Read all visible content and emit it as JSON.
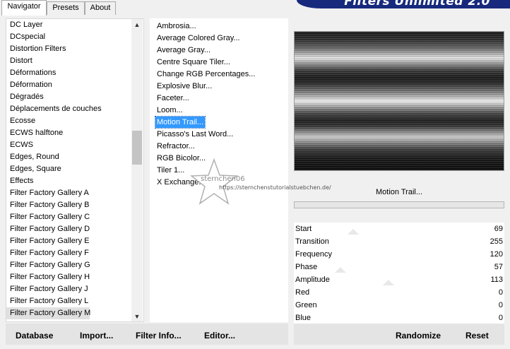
{
  "tabs": [
    {
      "label": "Navigator",
      "active": true
    },
    {
      "label": "Presets",
      "active": false
    },
    {
      "label": "About",
      "active": false
    }
  ],
  "brand": {
    "title": "Filters Unlimited 2.0"
  },
  "categories": {
    "items": [
      "DC Layer",
      "DCspecial",
      "Distortion Filters",
      "Distort",
      "Déformations",
      "Déformation",
      "Dégradés",
      "Déplacements de couches",
      "Ecosse",
      "ECWS halftone",
      "ECWS",
      "Edges, Round",
      "Edges, Square",
      "Effects",
      "Filter Factory Gallery A",
      "Filter Factory Gallery B",
      "Filter Factory Gallery C",
      "Filter Factory Gallery D",
      "Filter Factory Gallery E",
      "Filter Factory Gallery F",
      "Filter Factory Gallery G",
      "Filter Factory Gallery H",
      "Filter Factory Gallery J",
      "Filter Factory Gallery L",
      "Filter Factory Gallery M"
    ],
    "selected": "Filter Factory Gallery M",
    "scroll_position": 0.42
  },
  "filters": {
    "items": [
      "Ambrosia...",
      "Average Colored Gray...",
      "Average Gray...",
      "Centre Square Tiler...",
      "Change RGB Percentages...",
      "Explosive Blur...",
      "Faceter...",
      "Loom...",
      "Motion Trail...",
      "Picasso's Last Word...",
      "Refractor...",
      "RGB Bicolor...",
      "Tiler 1...",
      "X Exchange..."
    ],
    "selected": "Motion Trail..."
  },
  "watermark": {
    "name": "sternchen06",
    "url": "https://sternchenstutorialstuebchen.de/"
  },
  "filter_title": "Motion Trail...",
  "parameters": [
    {
      "label": "Start",
      "value": "69"
    },
    {
      "label": "Transition",
      "value": "255"
    },
    {
      "label": "Frequency",
      "value": "120"
    },
    {
      "label": "Phase",
      "value": "57"
    },
    {
      "label": "Amplitude",
      "value": "113"
    },
    {
      "label": "Red",
      "value": "0"
    },
    {
      "label": "Green",
      "value": "0"
    },
    {
      "label": "Blue",
      "value": "0"
    }
  ],
  "buttons": {
    "database": "Database",
    "import": "Import...",
    "filter_info": "Filter Info...",
    "editor": "Editor...",
    "randomize": "Randomize",
    "reset": "Reset"
  },
  "colors": {
    "selection": "#3399ff",
    "brand_banner": "#17297d"
  }
}
